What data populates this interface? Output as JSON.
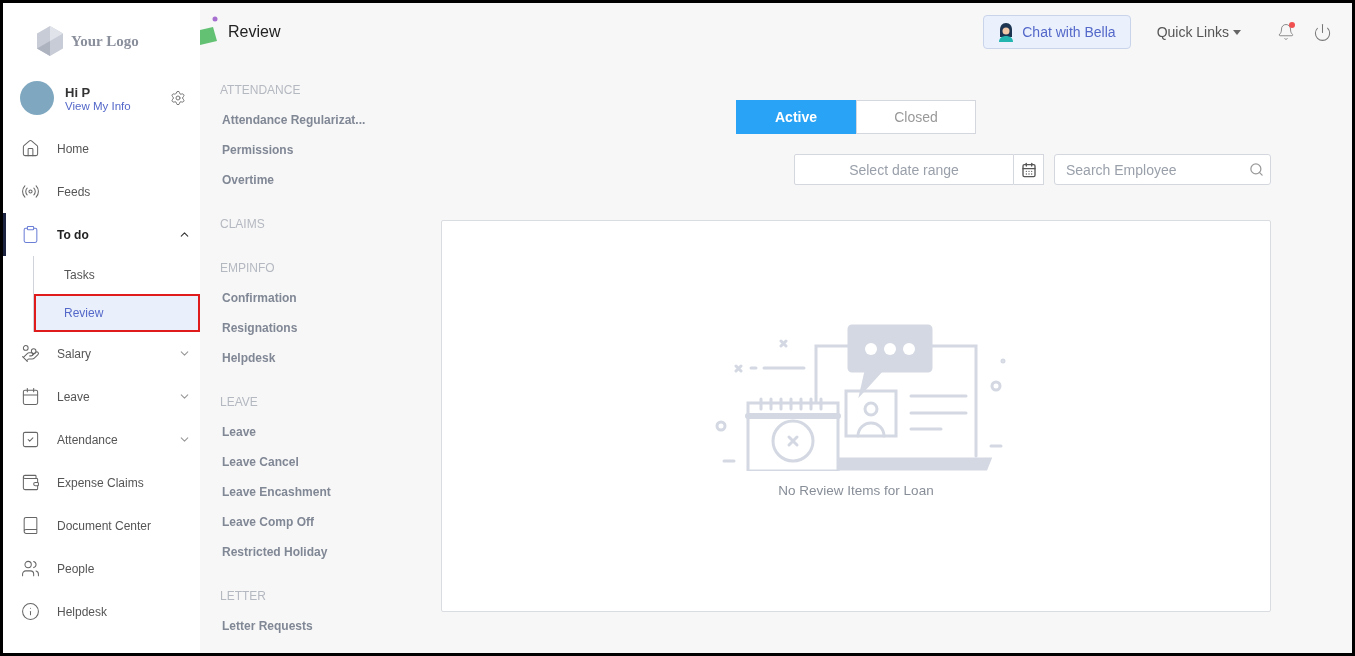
{
  "logo": {
    "text": "Your Logo"
  },
  "user": {
    "greeting": "Hi P",
    "link": "View My Info"
  },
  "nav": [
    {
      "label": "Home",
      "kind": "link",
      "selected": false
    },
    {
      "label": "Feeds",
      "kind": "link",
      "selected": false
    },
    {
      "label": "To do",
      "kind": "group",
      "expanded": true,
      "selected": true,
      "children": [
        {
          "label": "Tasks",
          "selected": false
        },
        {
          "label": "Review",
          "selected": true
        }
      ]
    },
    {
      "label": "Salary",
      "kind": "group",
      "expanded": false,
      "selected": false
    },
    {
      "label": "Leave",
      "kind": "group",
      "expanded": false,
      "selected": false
    },
    {
      "label": "Attendance",
      "kind": "group",
      "expanded": false,
      "selected": false
    },
    {
      "label": "Expense Claims",
      "kind": "link",
      "selected": false
    },
    {
      "label": "Document Center",
      "kind": "link",
      "selected": false
    },
    {
      "label": "People",
      "kind": "link",
      "selected": false
    },
    {
      "label": "Helpdesk",
      "kind": "link",
      "selected": false
    }
  ],
  "header": {
    "title": "Review",
    "chat_button": "Chat with Bella",
    "quick_links": "Quick Links",
    "notifications": {
      "unread": true
    }
  },
  "categories": [
    {
      "heading": "ATTENDANCE",
      "items": [
        "Attendance Regularizat...",
        "Permissions",
        "Overtime"
      ]
    },
    {
      "heading": "CLAIMS"
    },
    {
      "heading": "EMPINFO",
      "items": [
        "Confirmation",
        "Resignations",
        "Helpdesk"
      ]
    },
    {
      "heading": "LEAVE",
      "items": [
        "Leave",
        "Leave Cancel",
        "Leave Encashment",
        "Leave Comp Off",
        "Restricted Holiday"
      ]
    },
    {
      "heading": "LETTER",
      "items": [
        "Letter Requests"
      ]
    }
  ],
  "tabs": [
    {
      "label": "Active",
      "selected": true
    },
    {
      "label": "Closed",
      "selected": false
    }
  ],
  "filters": {
    "date": {
      "placeholder": "Select date range"
    },
    "search": {
      "placeholder": "Search Employee"
    }
  },
  "empty_state": {
    "message": "No Review Items for Loan"
  }
}
